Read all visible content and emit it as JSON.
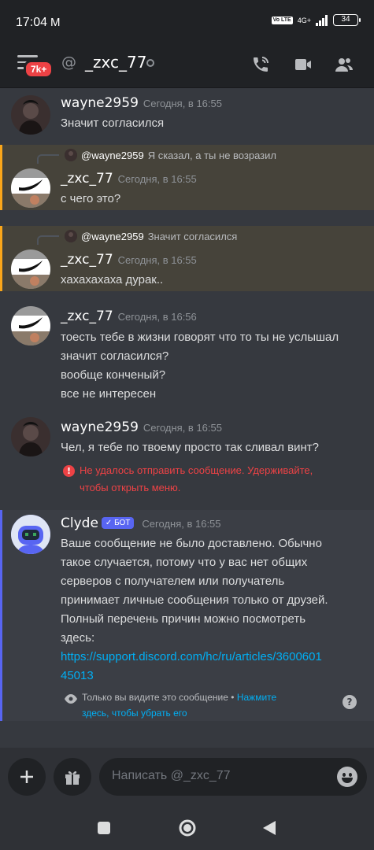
{
  "status_bar": {
    "time": "17:04",
    "notification": "M",
    "volte": "Vo LTE",
    "network": "4G+",
    "battery": "34"
  },
  "header": {
    "badge": "7k+",
    "channel_name": "_zxc_77"
  },
  "messages": [
    {
      "user": "wayne2959",
      "timestamp": "Сегодня, в 16:55",
      "lines": [
        "Значит согласился"
      ]
    },
    {
      "reply_to": "@wayne2959",
      "reply_text": "Я сказал, а ты не возразил",
      "user": "_zxc_77",
      "timestamp": "Сегодня, в 16:55",
      "lines": [
        "с чего это?"
      ]
    },
    {
      "reply_to": "@wayne2959",
      "reply_text": "Значит согласился",
      "user": "_zxc_77",
      "timestamp": "Сегодня, в 16:55",
      "lines": [
        "хахахахаха дурак.."
      ]
    },
    {
      "user": "_zxc_77",
      "timestamp": "Сегодня, в 16:56",
      "lines": [
        "тоесть тебе в жизни говорят что то ты не услышал",
        "значит согласился?",
        "вообще конченый?",
        "все не интересен"
      ]
    },
    {
      "user": "wayne2959",
      "timestamp": "Сегодня, в 16:55",
      "lines": [
        "Чел, я тебе по твоему просто так сливал винт?"
      ],
      "error_line1": "Не удалось отправить сообщение. Удерживайте,",
      "error_line2": "чтобы открыть меню."
    }
  ],
  "clyde": {
    "user": "Clyde",
    "badge": "БОТ",
    "timestamp": "Сегодня, в 16:55",
    "lines": [
      "Ваше сообщение не было доставлено. Обычно",
      "такое случается, потому что у вас нет общих",
      "серверов с получателем или получатель",
      "принимает личные сообщения только от друзей.",
      "Полный перечень причин можно посмотреть",
      "здесь:"
    ],
    "link_line1": "https://support.discord.com/hc/ru/articles/3600601",
    "link_line2": "45013",
    "only_you": "Только вы видите это сообщение •",
    "dismiss_part1": "Нажмите",
    "dismiss_part2": "здесь, чтобы убрать его",
    "help": "?"
  },
  "composer": {
    "placeholder": "Написать @_zxc_77"
  },
  "colors": {
    "background": "#36393f",
    "header": "#202225",
    "accent": "#5865f2",
    "error": "#ed4245",
    "highlight": "#46433a",
    "highlight_border": "#faa61a",
    "link": "#00aff4"
  }
}
